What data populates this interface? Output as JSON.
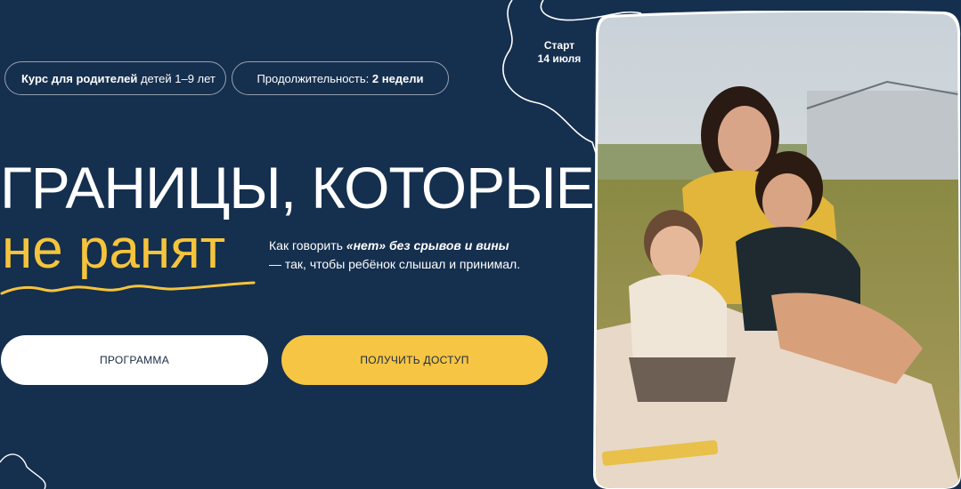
{
  "tags": {
    "course_bold": "Курс для родителей",
    "course_rest": " детей 1–9 лет",
    "duration_label": "Продолжительность: ",
    "duration_value": "2 недели"
  },
  "start": {
    "label": "Старт",
    "date": "14 июля"
  },
  "hero": {
    "title_line1": "ГРАНИЦЫ, КОТОРЫЕ",
    "title_line2": "не ранят",
    "subtitle_prefix": "Как говорить ",
    "subtitle_emphasis": "«нет» без срывов и вины",
    "subtitle_rest": "— так, чтобы ребёнок слышал и принимал."
  },
  "buttons": {
    "program": "ПРОГРАММА",
    "access": "ПОЛУЧИТЬ ДОСТУП"
  },
  "colors": {
    "background": "#152f4e",
    "accent_yellow": "#f5c43c",
    "text": "#ffffff"
  },
  "icons": {
    "squiggle": "wavy-underline-icon",
    "blob_outline": "blob-outline-decoration"
  }
}
